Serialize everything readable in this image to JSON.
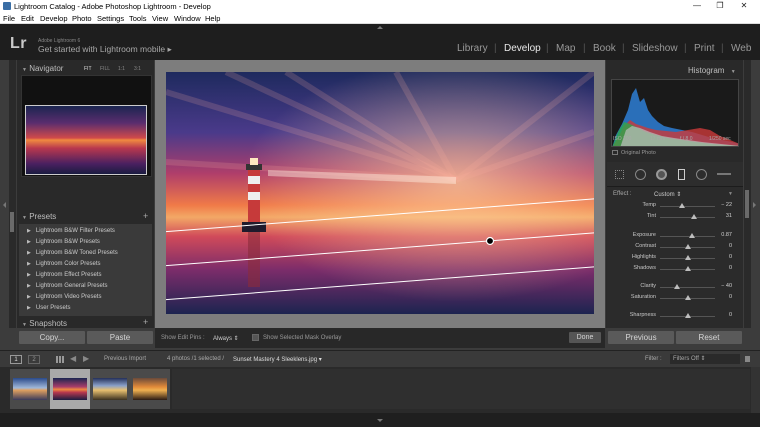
{
  "window": {
    "title": "Lightroom Catalog - Adobe Photoshop Lightroom - Develop",
    "controls": [
      "—",
      "❐",
      "✕"
    ]
  },
  "menu": [
    "File",
    "Edit",
    "Develop",
    "Photo",
    "Settings",
    "Tools",
    "View",
    "Window",
    "Help"
  ],
  "identity": {
    "logo": "Lr",
    "app_name": "Adobe Lightroom 6",
    "mobile_link": "Get started with Lightroom mobile  ▸"
  },
  "modules": [
    "Library",
    "Develop",
    "Map",
    "Book",
    "Slideshow",
    "Print",
    "Web"
  ],
  "active_module": "Develop",
  "navigator": {
    "title": "Navigator",
    "zoom_options": [
      "FIT",
      "FILL",
      "1:1",
      "3:1"
    ]
  },
  "presets": {
    "title": "Presets",
    "add": "+",
    "items": [
      "Lightroom B&W Filter Presets",
      "Lightroom B&W Presets",
      "Lightroom B&W Toned Presets",
      "Lightroom Color Presets",
      "Lightroom Effect Presets",
      "Lightroom General Presets",
      "Lightroom Video Presets",
      "User Presets"
    ]
  },
  "snapshots": {
    "title": "Snapshots",
    "add": "+"
  },
  "left_buttons": {
    "copy": "Copy...",
    "paste": "Paste"
  },
  "toolbar": {
    "show_edit_pins_label": "Show Edit Pins :",
    "show_edit_pins_value": "Always ⇕",
    "mask_overlay_label": "Show Selected Mask Overlay",
    "done": "Done"
  },
  "histogram": {
    "title": "Histogram",
    "iso": "ISO 100",
    "focal": "17 mm",
    "aperture": "f / 8.0",
    "shutter": "1/250 sec",
    "original_photo": "Original Photo"
  },
  "effect": {
    "label": "Effect :",
    "value": "Custom ⇕"
  },
  "sliders": [
    {
      "label": "Temp",
      "value": "− 22",
      "level": 0.4
    },
    {
      "label": "Tint",
      "value": "31",
      "level": 0.62
    },
    {
      "label": "Exposure",
      "value": "0.87",
      "level": 0.58
    },
    {
      "label": "Contrast",
      "value": "0",
      "level": 0.5
    },
    {
      "label": "Highlights",
      "value": "0",
      "level": 0.5
    },
    {
      "label": "Shadows",
      "value": "0",
      "level": 0.5
    },
    {
      "label": "Clarity",
      "value": "− 40",
      "level": 0.3
    },
    {
      "label": "Saturation",
      "value": "0",
      "level": 0.5
    },
    {
      "label": "Sharpness",
      "value": "0",
      "level": 0.5
    }
  ],
  "right_buttons": {
    "previous": "Previous",
    "reset": "Reset"
  },
  "filmbar": {
    "view1": "1",
    "view2": "2",
    "source": "Previous Import",
    "status": "4 photos /1 selected /",
    "filename": "Sunset Mastery 4 Sleeklens.jpg ▾",
    "filter_label": "Filter :",
    "filter_value": "Filters Off ⇕"
  },
  "colors": {
    "panel": "#292929",
    "background": "#3c3c3c",
    "selected_thumb": "#a9a9a9"
  }
}
